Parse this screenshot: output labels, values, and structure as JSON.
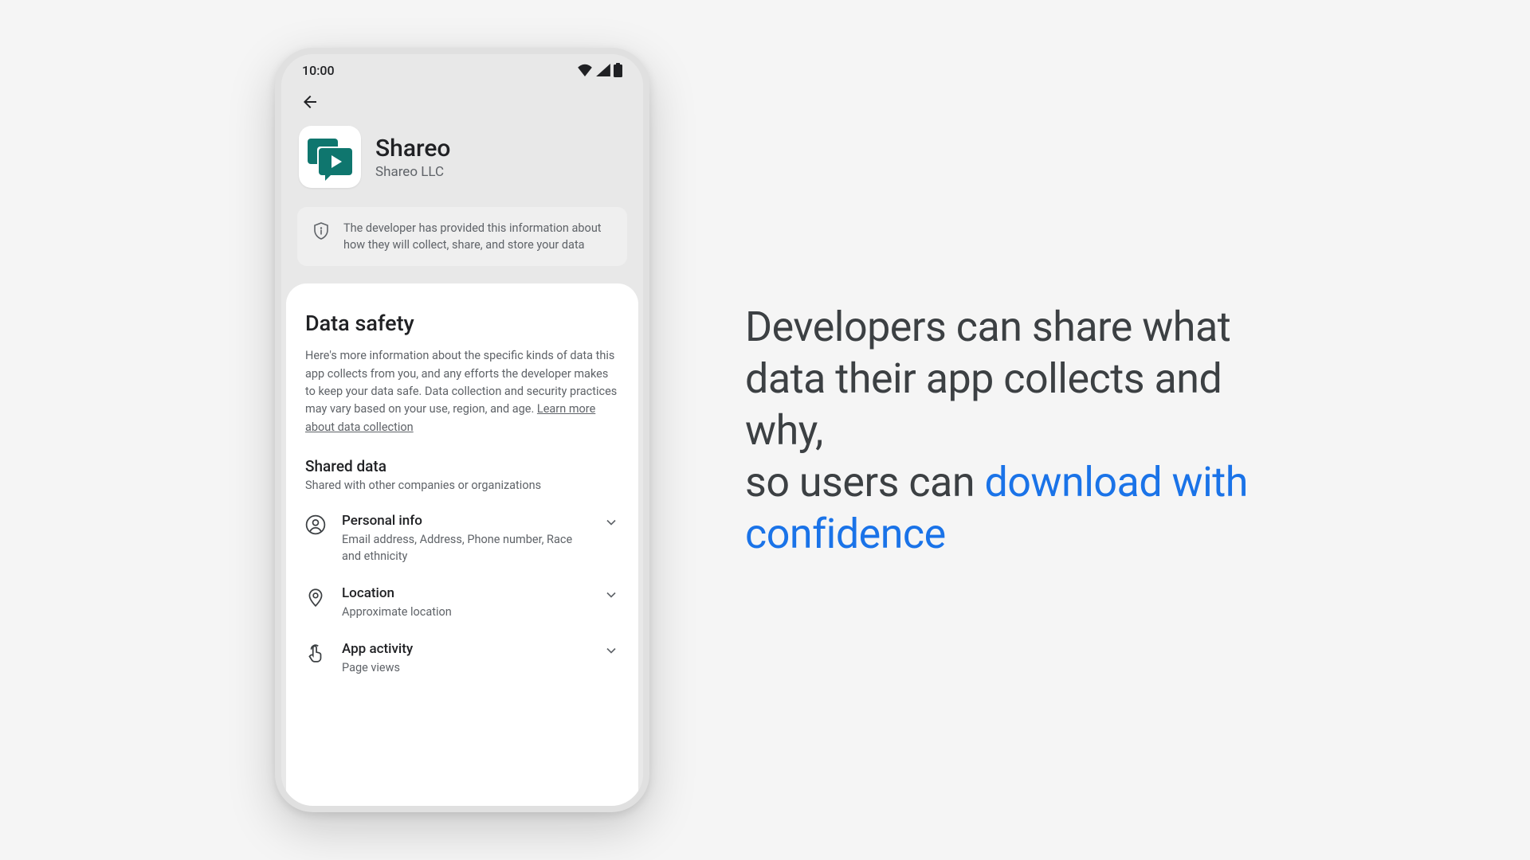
{
  "status": {
    "time": "10:00"
  },
  "app": {
    "name": "Shareo",
    "developer": "Shareo LLC"
  },
  "notice": {
    "text": "The developer has provided this information about how they will collect, share, and store your data"
  },
  "data_safety": {
    "title": "Data safety",
    "body": "Here's more information about the specific kinds of data this app collects from you, and any efforts the developer makes to keep your data safe. Data collection and security practices may vary based on your use, region, and age. ",
    "learn_more": "Learn more about data collection"
  },
  "shared": {
    "title": "Shared data",
    "subtitle": "Shared with other companies or organizations",
    "items": [
      {
        "icon": "person",
        "title": "Personal info",
        "subtitle": "Email address, Address, Phone number, Race and ethnicity"
      },
      {
        "icon": "location",
        "title": "Location",
        "subtitle": "Approximate location"
      },
      {
        "icon": "activity",
        "title": "App activity",
        "subtitle": "Page views"
      }
    ]
  },
  "hero": {
    "line1": "Developers can share what data their app collects and why,",
    "line2": "so users can ",
    "highlight": "download with confidence"
  }
}
